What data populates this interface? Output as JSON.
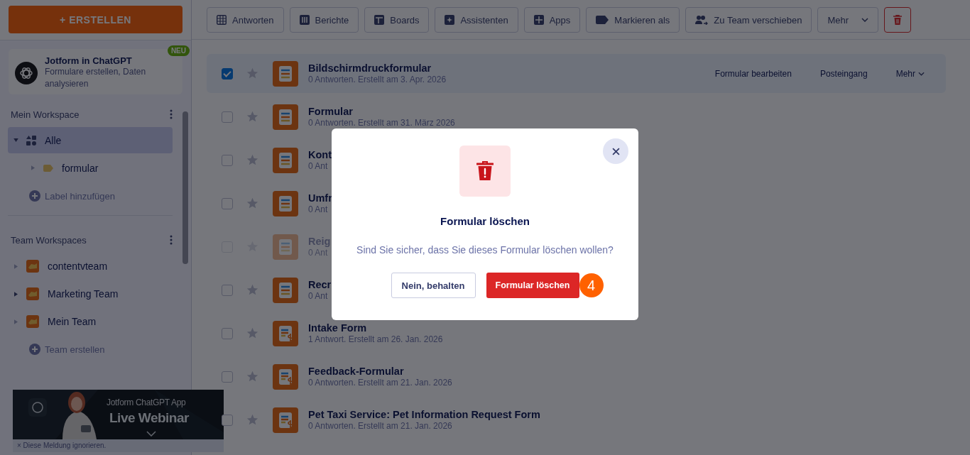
{
  "create_button": "+ ERSTELLEN",
  "promo": {
    "title": "Jotform in ChatGPT",
    "text": "Formulare erstellen, Daten analysieren",
    "badge": "NEU"
  },
  "my_workspace": {
    "title": "Mein Workspace",
    "items": [
      {
        "label": "Alle",
        "selected": true,
        "expanded": true,
        "children": [
          {
            "label": "formular",
            "selected": false,
            "expanded": false
          }
        ]
      }
    ],
    "add_label": "Label hinzufügen"
  },
  "team_workspaces": {
    "title": "Team Workspaces",
    "teams": [
      {
        "label": "contentvteam",
        "has_children": false
      },
      {
        "label": "Marketing Team",
        "has_children": true
      },
      {
        "label": "Mein Team",
        "has_children": false
      }
    ],
    "add_team": "Team erstellen"
  },
  "banner": {
    "line1": "Jotform ChatGPT App",
    "line2": "Live Webinar",
    "dismiss": "× Diese Meldung ignorieren."
  },
  "toolbar": [
    {
      "label": "Antworten",
      "kind": "grid"
    },
    {
      "label": "Berichte",
      "kind": "chart"
    },
    {
      "label": "Boards",
      "kind": "board"
    },
    {
      "label": "Assistenten",
      "kind": "spark"
    },
    {
      "label": "Apps",
      "kind": "apps"
    },
    {
      "label": "Markieren als",
      "kind": "tag"
    },
    {
      "label": "Zu Team verschieben",
      "kind": "team"
    },
    {
      "label": "Mehr",
      "kind": "more"
    }
  ],
  "forms": [
    {
      "title": "Bildschirmdruckformular",
      "meta": "0 Antworten. Erstellt am 3. Apr. 2026",
      "checked": true,
      "disabled": false,
      "kind": "form",
      "actions": [
        "Formular bearbeiten",
        "Posteingang",
        "Mehr"
      ]
    },
    {
      "title": "Formular",
      "meta": "0 Antworten. Erstellt am 31. März 2026",
      "checked": false,
      "disabled": false,
      "kind": "form"
    },
    {
      "title": "Kont",
      "meta": "0 Ant",
      "checked": false,
      "disabled": false,
      "kind": "form"
    },
    {
      "title": "Umfr",
      "meta": "0 Ant",
      "checked": false,
      "disabled": false,
      "kind": "form"
    },
    {
      "title": "Reig",
      "meta": "0 Ant",
      "checked": false,
      "disabled": true,
      "kind": "form"
    },
    {
      "title": "Recr",
      "meta": "0 Ant",
      "checked": false,
      "disabled": false,
      "kind": "form"
    },
    {
      "title": "Intake Form",
      "meta": "1 Antwort. Erstellt am 26. Jan. 2026",
      "checked": false,
      "disabled": false,
      "kind": "payment"
    },
    {
      "title": "Feedback-Formular",
      "meta": "0 Antworten. Erstellt am 21. Jan. 2026",
      "checked": false,
      "disabled": false,
      "kind": "payment"
    },
    {
      "title": "Pet Taxi Service: Pet Information Request Form",
      "meta": "0 Antworten. Erstellt am 21. Jan. 2026",
      "checked": false,
      "disabled": false,
      "kind": "payment"
    }
  ],
  "dialog": {
    "title": "Formular löschen",
    "message": "Sind Sie sicher, dass Sie dieses Formular löschen wollen?",
    "cancel": "Nein, behalten",
    "confirm": "Formular löschen",
    "step": "4"
  }
}
